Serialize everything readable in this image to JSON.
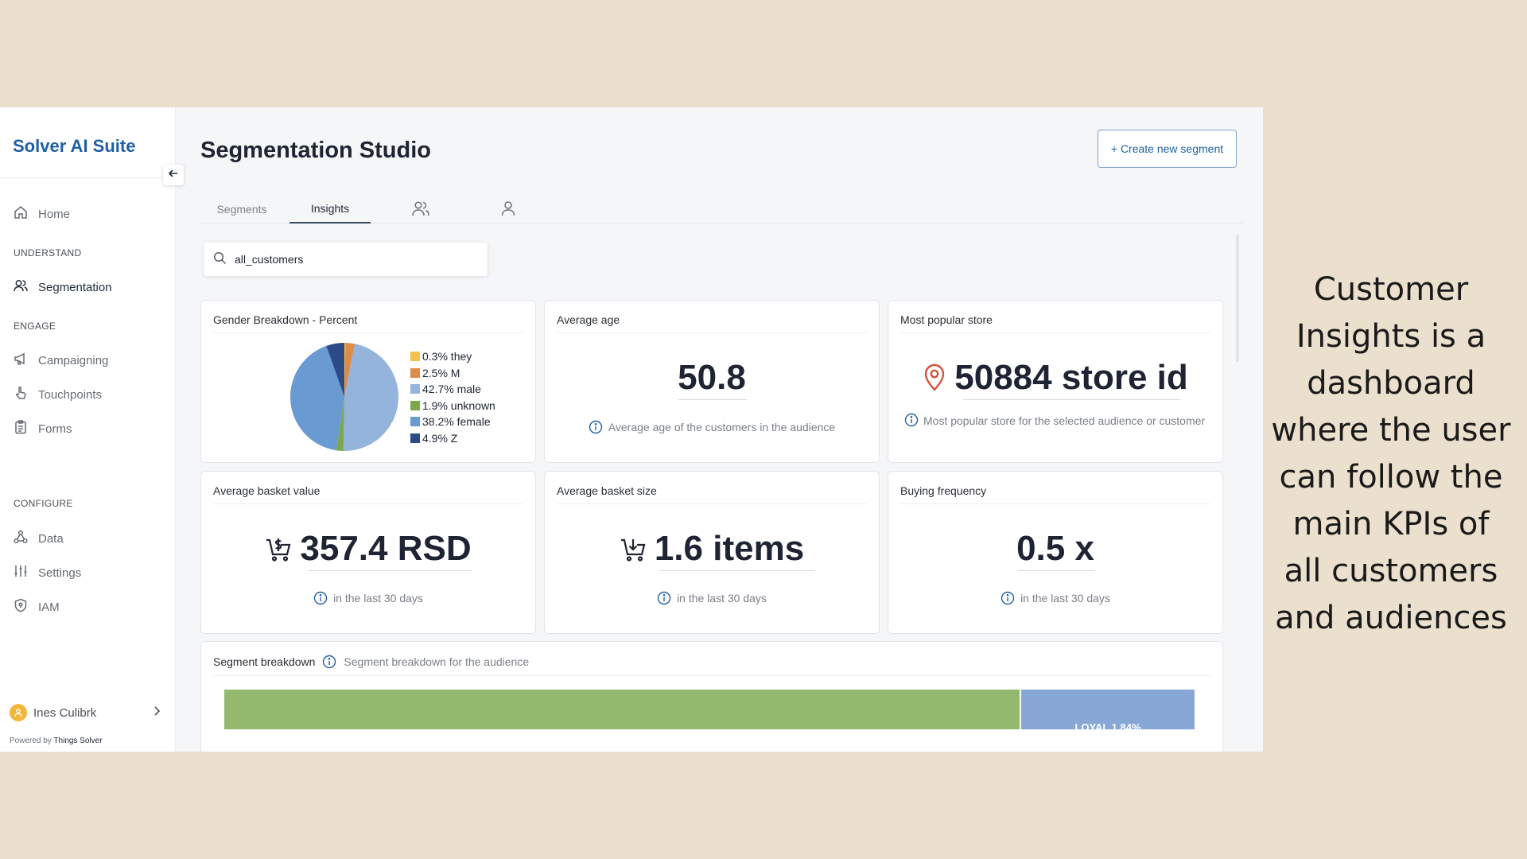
{
  "sidebar": {
    "brand": "Solver AI Suite",
    "home": "Home",
    "understand_label": "UNDERSTAND",
    "segmentation": "Segmentation",
    "engage_label": "ENGAGE",
    "campaigning": "Campaigning",
    "touchpoints": "Touchpoints",
    "forms": "Forms",
    "configure_label": "CONFIGURE",
    "data": "Data",
    "settings": "Settings",
    "iam": "IAM",
    "user_name": "Ines Culibrk",
    "powered_by": "Powered by",
    "powered_brand": "Things Solver"
  },
  "header": {
    "title": "Segmentation Studio",
    "create_button": "+ Create new segment"
  },
  "tabs": [
    {
      "label": "Segments"
    },
    {
      "label": "Insights",
      "active": true
    }
  ],
  "search": {
    "value": "all_customers"
  },
  "cards": {
    "gender": {
      "title": "Gender Breakdown - Percent",
      "legend": [
        "0.3% they",
        "2.5% M",
        "42.7% male",
        "1.9% unknown",
        "38.2% female",
        "4.9% Z"
      ]
    },
    "avg_age": {
      "title": "Average age",
      "value": "50.8",
      "note": "Average age of the customers in the audience"
    },
    "popular_store": {
      "title": "Most popular store",
      "value": "50884 store id",
      "note": "Most popular store for the selected audience or customer"
    },
    "basket_value": {
      "title": "Average basket value",
      "value": "357.4 RSD",
      "note": "in the last 30 days"
    },
    "basket_size": {
      "title": "Average basket size",
      "value": "1.6 items",
      "note": "in the last 30 days"
    },
    "buying_freq": {
      "title": "Buying frequency",
      "value": "0.5 x",
      "note": "in the last 30 days"
    },
    "segment": {
      "title": "Segment breakdown",
      "note": "Segment breakdown for the audience",
      "loyal_label": "LOYAL 1.84%"
    }
  },
  "chart_data": {
    "type": "pie",
    "title": "Gender Breakdown - Percent",
    "series": [
      {
        "name": "they",
        "value": 0.3,
        "color": "#f2c14e"
      },
      {
        "name": "M",
        "value": 2.5,
        "color": "#e08a4a"
      },
      {
        "name": "male",
        "value": 42.7,
        "color": "#94b4dc"
      },
      {
        "name": "unknown",
        "value": 1.9,
        "color": "#7ba84b"
      },
      {
        "name": "female",
        "value": 38.2,
        "color": "#6a9ad2"
      },
      {
        "name": "Z",
        "value": 4.9,
        "color": "#2c4a86"
      }
    ],
    "legend_position": "right"
  },
  "colors": {
    "brand": "#1f5fa3",
    "segment_green": "#93b96f",
    "segment_blue": "#87a8d6",
    "store_pin": "#d2553a",
    "info": "#1f5fa3"
  },
  "caption": "Customer Insights is a dashboard where the user can follow the main KPIs of all customers and audiences"
}
